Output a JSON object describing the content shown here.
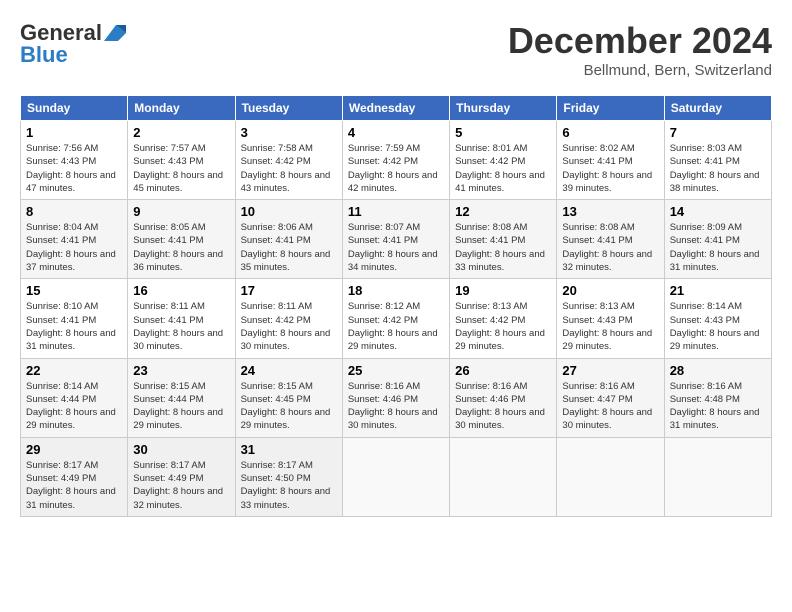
{
  "header": {
    "logo_line1": "General",
    "logo_line2": "Blue",
    "title": "December 2024",
    "subtitle": "Bellmund, Bern, Switzerland"
  },
  "days_of_week": [
    "Sunday",
    "Monday",
    "Tuesday",
    "Wednesday",
    "Thursday",
    "Friday",
    "Saturday"
  ],
  "weeks": [
    [
      {
        "day": "1",
        "sunrise": "7:56 AM",
        "sunset": "4:43 PM",
        "daylight": "8 hours and 47 minutes."
      },
      {
        "day": "2",
        "sunrise": "7:57 AM",
        "sunset": "4:43 PM",
        "daylight": "8 hours and 45 minutes."
      },
      {
        "day": "3",
        "sunrise": "7:58 AM",
        "sunset": "4:42 PM",
        "daylight": "8 hours and 43 minutes."
      },
      {
        "day": "4",
        "sunrise": "7:59 AM",
        "sunset": "4:42 PM",
        "daylight": "8 hours and 42 minutes."
      },
      {
        "day": "5",
        "sunrise": "8:01 AM",
        "sunset": "4:42 PM",
        "daylight": "8 hours and 41 minutes."
      },
      {
        "day": "6",
        "sunrise": "8:02 AM",
        "sunset": "4:41 PM",
        "daylight": "8 hours and 39 minutes."
      },
      {
        "day": "7",
        "sunrise": "8:03 AM",
        "sunset": "4:41 PM",
        "daylight": "8 hours and 38 minutes."
      }
    ],
    [
      {
        "day": "8",
        "sunrise": "8:04 AM",
        "sunset": "4:41 PM",
        "daylight": "8 hours and 37 minutes."
      },
      {
        "day": "9",
        "sunrise": "8:05 AM",
        "sunset": "4:41 PM",
        "daylight": "8 hours and 36 minutes."
      },
      {
        "day": "10",
        "sunrise": "8:06 AM",
        "sunset": "4:41 PM",
        "daylight": "8 hours and 35 minutes."
      },
      {
        "day": "11",
        "sunrise": "8:07 AM",
        "sunset": "4:41 PM",
        "daylight": "8 hours and 34 minutes."
      },
      {
        "day": "12",
        "sunrise": "8:08 AM",
        "sunset": "4:41 PM",
        "daylight": "8 hours and 33 minutes."
      },
      {
        "day": "13",
        "sunrise": "8:08 AM",
        "sunset": "4:41 PM",
        "daylight": "8 hours and 32 minutes."
      },
      {
        "day": "14",
        "sunrise": "8:09 AM",
        "sunset": "4:41 PM",
        "daylight": "8 hours and 31 minutes."
      }
    ],
    [
      {
        "day": "15",
        "sunrise": "8:10 AM",
        "sunset": "4:41 PM",
        "daylight": "8 hours and 31 minutes."
      },
      {
        "day": "16",
        "sunrise": "8:11 AM",
        "sunset": "4:41 PM",
        "daylight": "8 hours and 30 minutes."
      },
      {
        "day": "17",
        "sunrise": "8:11 AM",
        "sunset": "4:42 PM",
        "daylight": "8 hours and 30 minutes."
      },
      {
        "day": "18",
        "sunrise": "8:12 AM",
        "sunset": "4:42 PM",
        "daylight": "8 hours and 29 minutes."
      },
      {
        "day": "19",
        "sunrise": "8:13 AM",
        "sunset": "4:42 PM",
        "daylight": "8 hours and 29 minutes."
      },
      {
        "day": "20",
        "sunrise": "8:13 AM",
        "sunset": "4:43 PM",
        "daylight": "8 hours and 29 minutes."
      },
      {
        "day": "21",
        "sunrise": "8:14 AM",
        "sunset": "4:43 PM",
        "daylight": "8 hours and 29 minutes."
      }
    ],
    [
      {
        "day": "22",
        "sunrise": "8:14 AM",
        "sunset": "4:44 PM",
        "daylight": "8 hours and 29 minutes."
      },
      {
        "day": "23",
        "sunrise": "8:15 AM",
        "sunset": "4:44 PM",
        "daylight": "8 hours and 29 minutes."
      },
      {
        "day": "24",
        "sunrise": "8:15 AM",
        "sunset": "4:45 PM",
        "daylight": "8 hours and 29 minutes."
      },
      {
        "day": "25",
        "sunrise": "8:16 AM",
        "sunset": "4:46 PM",
        "daylight": "8 hours and 30 minutes."
      },
      {
        "day": "26",
        "sunrise": "8:16 AM",
        "sunset": "4:46 PM",
        "daylight": "8 hours and 30 minutes."
      },
      {
        "day": "27",
        "sunrise": "8:16 AM",
        "sunset": "4:47 PM",
        "daylight": "8 hours and 30 minutes."
      },
      {
        "day": "28",
        "sunrise": "8:16 AM",
        "sunset": "4:48 PM",
        "daylight": "8 hours and 31 minutes."
      }
    ],
    [
      {
        "day": "29",
        "sunrise": "8:17 AM",
        "sunset": "4:49 PM",
        "daylight": "8 hours and 31 minutes."
      },
      {
        "day": "30",
        "sunrise": "8:17 AM",
        "sunset": "4:49 PM",
        "daylight": "8 hours and 32 minutes."
      },
      {
        "day": "31",
        "sunrise": "8:17 AM",
        "sunset": "4:50 PM",
        "daylight": "8 hours and 33 minutes."
      },
      null,
      null,
      null,
      null
    ]
  ],
  "labels": {
    "sunrise": "Sunrise:",
    "sunset": "Sunset:",
    "daylight": "Daylight:"
  }
}
